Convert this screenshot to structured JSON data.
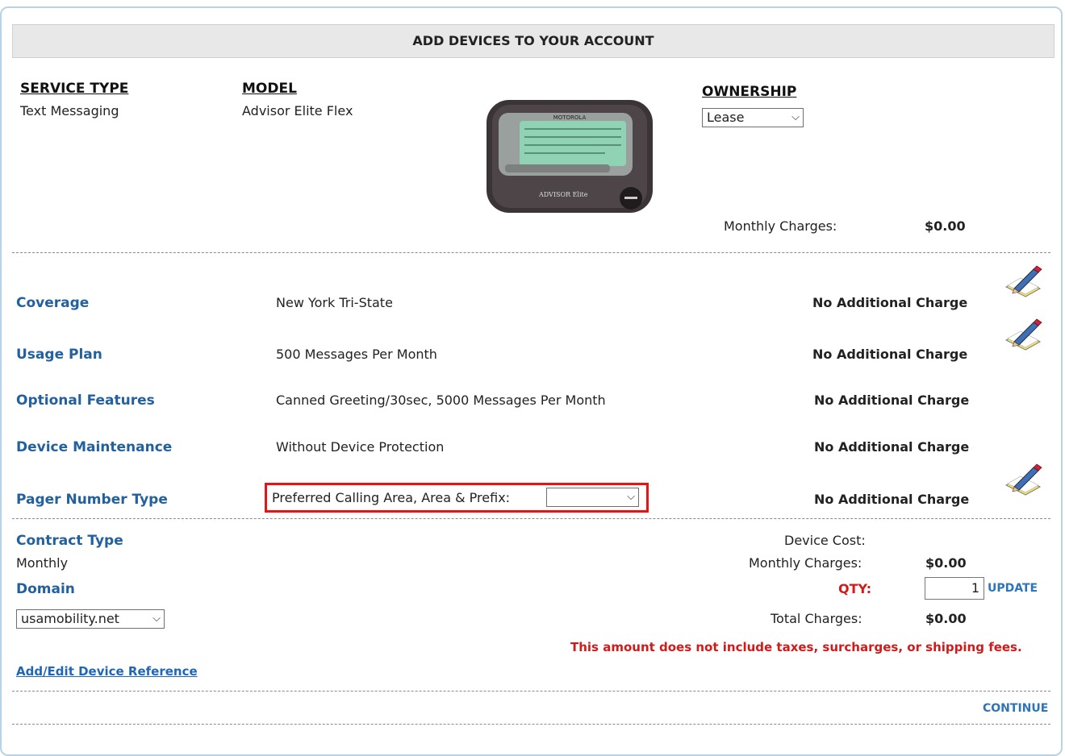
{
  "header": {
    "title": "ADD DEVICES TO YOUR ACCOUNT"
  },
  "columns": {
    "service_type_label": "SERVICE TYPE",
    "service_type_value": "Text Messaging",
    "model_label": "MODEL",
    "model_value": "Advisor Elite Flex",
    "ownership_label": "OWNERSHIP",
    "ownership_selected": "Lease"
  },
  "device_image": {
    "brand": "MOTOROLA",
    "name": "ADVISOR Elite",
    "icon": "pager-device-image"
  },
  "monthly_charges": {
    "label": "Monthly Charges:",
    "value": "$0.00"
  },
  "options": [
    {
      "label": "Coverage",
      "value": "New York Tri-State",
      "charge": "No Additional Charge",
      "editable": true
    },
    {
      "label": "Usage Plan",
      "value": "500 Messages Per Month",
      "charge": "No Additional Charge",
      "editable": true
    },
    {
      "label": "Optional Features",
      "value": "Canned Greeting/30sec, 5000 Messages Per Month",
      "charge": "No Additional Charge",
      "editable": false
    },
    {
      "label": "Device Maintenance",
      "value": "Without Device Protection",
      "charge": "No Additional Charge",
      "editable": false
    },
    {
      "label": "Pager Number Type",
      "value": "Preferred Calling Area, Area & Prefix:",
      "select_value": "",
      "charge": "No Additional Charge",
      "editable": true
    }
  ],
  "contract": {
    "label": "Contract Type",
    "value": "Monthly"
  },
  "domain": {
    "label": "Domain",
    "selected": "usamobility.net"
  },
  "totals": {
    "device_cost_label": "Device Cost:",
    "monthly_label": "Monthly Charges:",
    "monthly_value": "$0.00",
    "qty_label": "QTY:",
    "qty_value": "1",
    "update_label": "UPDATE",
    "total_label": "Total Charges:",
    "total_value": "$0.00"
  },
  "disclaimer": "This amount does not include taxes, surcharges, or shipping fees.",
  "device_reference_link": "Add/Edit Device Reference",
  "continue_label": "CONTINUE",
  "colors": {
    "link_blue": "#22609e",
    "alert_red": "#d11a1a",
    "highlight": "#ee1111"
  }
}
